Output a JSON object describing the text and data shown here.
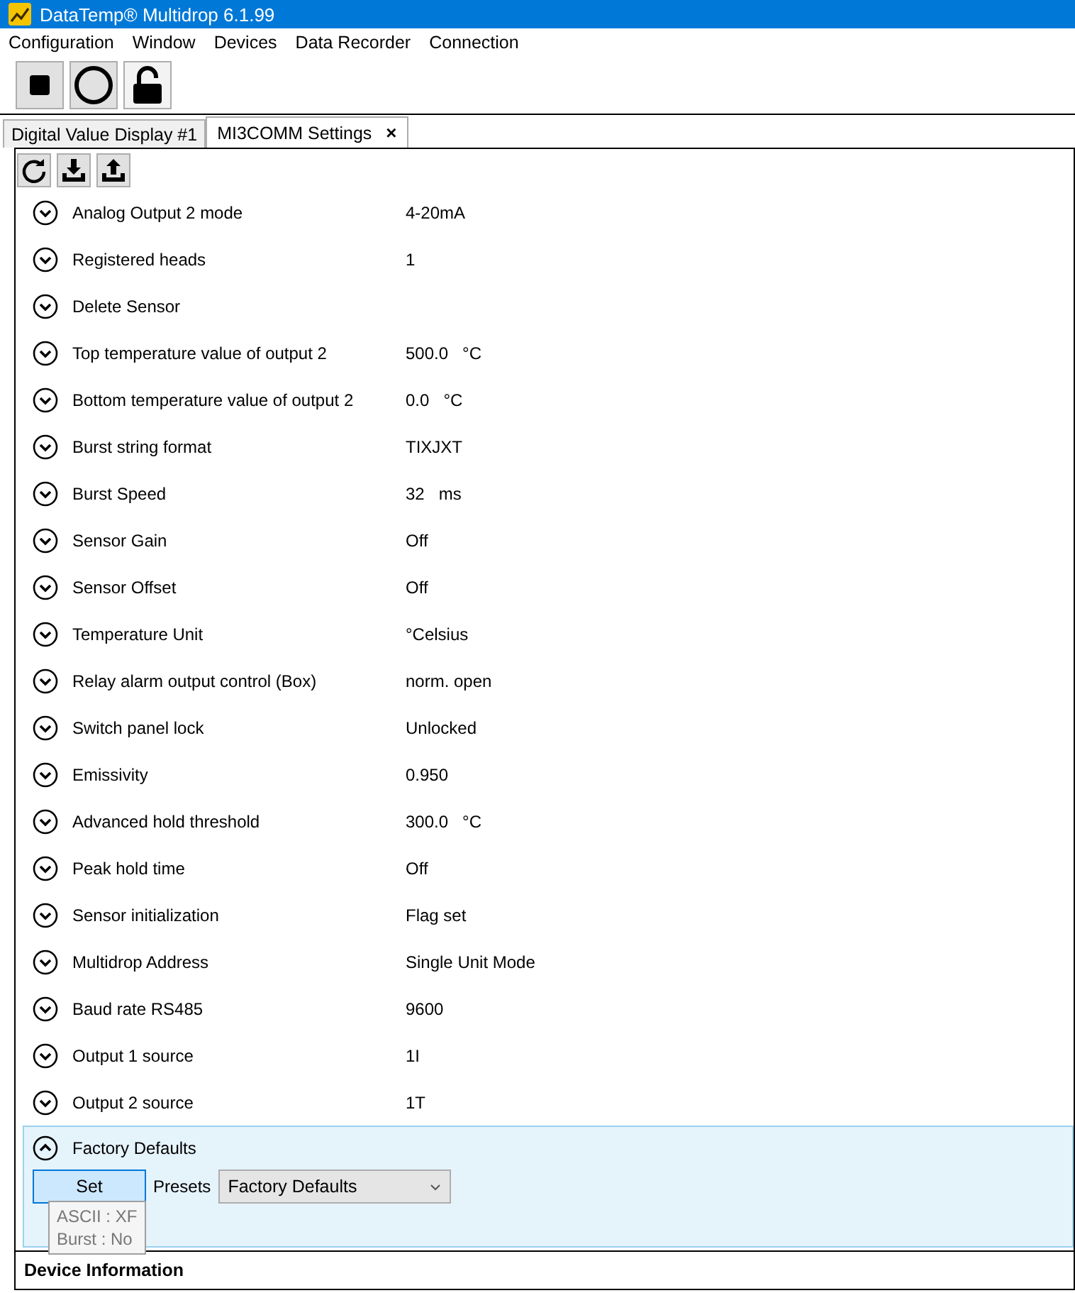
{
  "window": {
    "title": "DataTemp® Multidrop 6.1.99"
  },
  "menu": [
    "Configuration",
    "Window",
    "Devices",
    "Data Recorder",
    "Connection"
  ],
  "toolbar": [
    {
      "kind": "stop"
    },
    {
      "kind": "record"
    },
    {
      "kind": "unlock"
    }
  ],
  "tabs": [
    {
      "label": "Digital Value Display #1",
      "selected": false
    },
    {
      "label": "MI3COMM Settings",
      "selected": true,
      "close": "×"
    }
  ],
  "panel_toolbar": [
    {
      "kind": "refresh"
    },
    {
      "kind": "download"
    },
    {
      "kind": "upload"
    }
  ],
  "settings": [
    {
      "label": "Analog Output 2 mode",
      "value": "4-20mA",
      "expanded": false
    },
    {
      "label": "Registered heads",
      "value": "1",
      "expanded": false
    },
    {
      "label": "Delete Sensor",
      "expanded": false
    },
    {
      "label": "Top temperature value of output 2",
      "value": "500.0",
      "unit": "°C",
      "expanded": false
    },
    {
      "label": "Bottom temperature value of output 2",
      "value": "0.0",
      "unit": "°C",
      "expanded": false
    },
    {
      "label": "Burst string format",
      "value": "TIXJXT",
      "expanded": false
    },
    {
      "label": "Burst Speed",
      "value": "32",
      "unit": "ms",
      "expanded": false
    },
    {
      "label": "Sensor Gain",
      "value": "Off",
      "expanded": false
    },
    {
      "label": "Sensor Offset",
      "value": "Off",
      "expanded": false
    },
    {
      "label": "Temperature Unit",
      "value": "°Celsius",
      "expanded": false
    },
    {
      "label": "Relay alarm output control (Box)",
      "value": "norm. open",
      "expanded": false
    },
    {
      "label": "Switch panel lock",
      "value": "Unlocked",
      "expanded": false
    },
    {
      "label": "Emissivity",
      "value": "0.950",
      "expanded": false
    },
    {
      "label": "Advanced hold threshold",
      "value": "300.0",
      "unit": "°C",
      "expanded": false
    },
    {
      "label": "Peak hold time",
      "value": "Off",
      "expanded": false
    },
    {
      "label": "Sensor initialization",
      "value": "Flag set",
      "expanded": false
    },
    {
      "label": "Multidrop Address",
      "value": "Single Unit Mode",
      "expanded": false
    },
    {
      "label": "Baud rate RS485",
      "value": "9600",
      "expanded": false
    },
    {
      "label": "Output 1 source",
      "value": "1I",
      "expanded": false
    },
    {
      "label": "Output 2 source",
      "value": "1T",
      "expanded": false
    },
    {
      "label": "Factory Defaults",
      "expanded": true,
      "button": "Set",
      "presets_label": "Presets",
      "preset": "Factory Defaults"
    }
  ],
  "tooltip": [
    "ASCII : XF",
    "Burst : No"
  ],
  "section": {
    "title": "Device Information"
  }
}
